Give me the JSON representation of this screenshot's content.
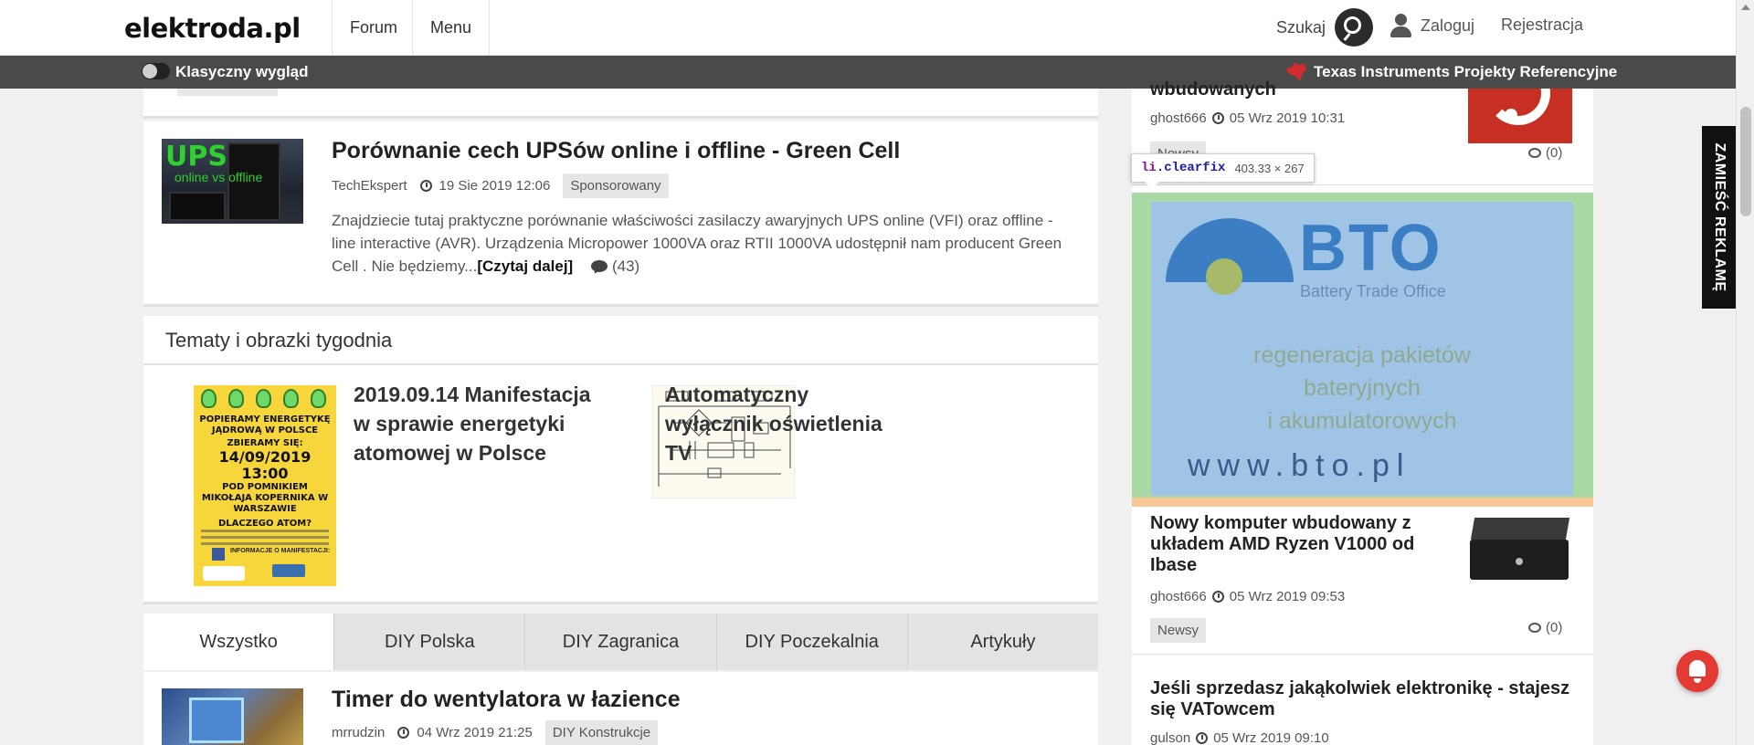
{
  "header": {
    "logo": "elektroda.pl",
    "nav": [
      "Forum",
      "Menu"
    ],
    "search_label": "Szukaj",
    "login_label": "Zaloguj",
    "register_label": "Rejestracja"
  },
  "subbar": {
    "toggle_label": "Klasyczny wygląd",
    "ti_label": "Texas Instruments Projekty Referencyjne"
  },
  "article1": {
    "thumb_big": "UPS",
    "thumb_small": "online vs offline",
    "title": "Porównanie cech UPSów online i offline - Green Cell",
    "author": "TechEkspert",
    "date": "19 Sie 2019 12:06",
    "tag": "Sponsorowany",
    "excerpt": "Znajdziecie tutaj praktyczne porównanie właściwości zasilaczy awaryjnych UPS online (VFI) oraz offline - line interactive (AVR). Urządzenia Micropower 1000VA oraz RTII 1000VA udostępnił nam producent Green Cell . Nie będziemy...",
    "read_more": "[Czytaj dalej]",
    "comments": "(43)"
  },
  "weekly": {
    "section_title": "Tematy i obrazki tygodnia",
    "poster": {
      "line1": "POPIERAMY ENERGETYKĘ JĄDROWĄ W POLSCE",
      "line2": "ZBIERAMY SIĘ:",
      "line3": "14/09/2019 13:00",
      "line4": "POD POMNIKIEM MIKOŁAJA KOPERNIKA W WARSZAWIE",
      "line5": "DLACZEGO ATOM?",
      "line6": "INFORMACJE O MANIFESTACJI:"
    },
    "item1_title": "2019.09.14 Manifestacja w sprawie energetyki atomowej w Polsce",
    "item2_title": "Automatyczny wyłącznik oświetlenia TV"
  },
  "tabs": [
    "Wszystko",
    "DIY Polska",
    "DIY Zagranica",
    "DIY Poczekalnia",
    "Artykuły"
  ],
  "article2": {
    "title": "Timer do wentylatora w łazience",
    "author": "mrrudzin",
    "date": "04 Wrz 2019 21:25",
    "tag": "DIY Konstrukcje"
  },
  "right": {
    "item0_title": "wbudowanych",
    "item0_author": "ghost666",
    "item0_date": "05 Wrz 2019 10:31",
    "item0_tag": "Newsy",
    "item0_comments": "(0)",
    "ad": {
      "logo": "BTO",
      "subtitle": "Battery Trade Office",
      "text1": "regeneracja pakietów",
      "text2": "bateryjnych",
      "text3": "i akumulatorowych",
      "url": "www.bto.pl"
    },
    "item1_title": "Nowy komputer wbudowany z układem AMD Ryzen V1000 od Ibase",
    "item1_author": "ghost666",
    "item1_date": "05 Wrz 2019 09:53",
    "item1_tag": "Newsy",
    "item1_comments": "(0)",
    "item2_title": "Jeśli sprzedasz jakąkolwiek elektronikę - stajesz się VATowcem",
    "item2_author": "gulson",
    "item2_date": "05 Wrz 2019 09:10"
  },
  "devtools_tip": {
    "selector_tag": "li",
    "selector_class": ".clearfix",
    "dimensions": "403.33 × 267"
  },
  "side_ad": "ZAMIEŚĆ REKLAMĘ",
  "colors": {
    "subbar_bg": "#4a4a4a",
    "notification": "#e33b33",
    "ad_bg": "#9fc4e6"
  }
}
